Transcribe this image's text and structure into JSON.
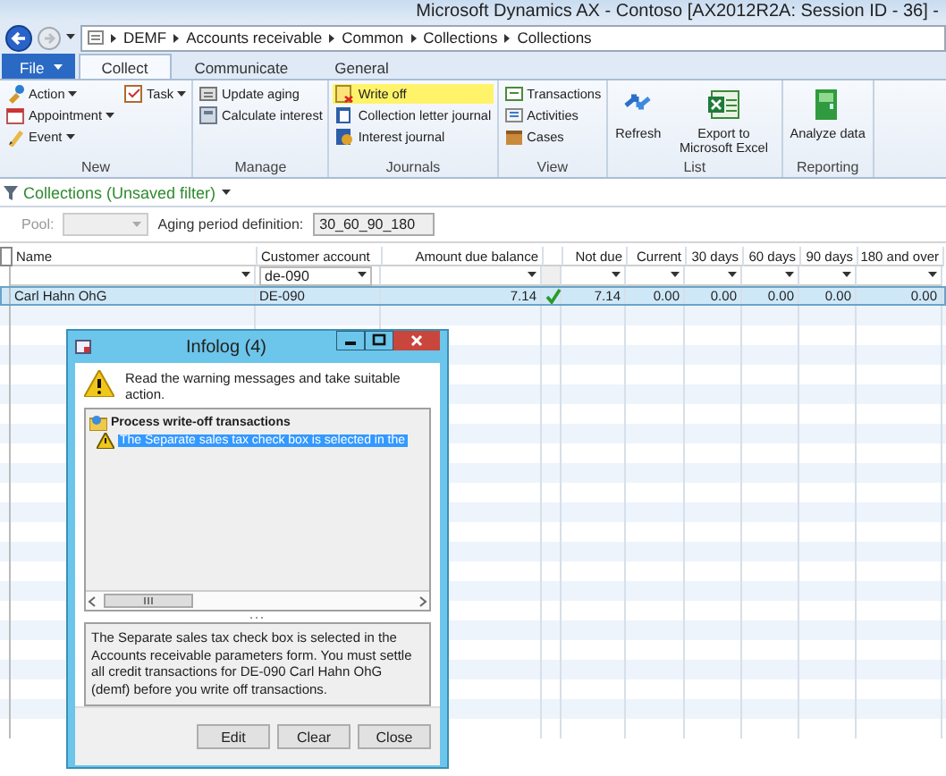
{
  "window": {
    "title": "Microsoft Dynamics AX - Contoso [AX2012R2A: Session ID - 36] -"
  },
  "breadcrumb": [
    "DEMF",
    "Accounts receivable",
    "Common",
    "Collections",
    "Collections"
  ],
  "ribbon_tabs": [
    {
      "label": "File",
      "kind": "file",
      "selected": false
    },
    {
      "label": "Collect",
      "kind": "tab",
      "selected": true
    },
    {
      "label": "Communicate",
      "kind": "tab",
      "selected": false
    },
    {
      "label": "General",
      "kind": "tab",
      "selected": false
    }
  ],
  "ribbon_groups": [
    {
      "label": "New",
      "columns": [
        [
          {
            "label": "Action",
            "kind": "small",
            "dropdown": true
          },
          {
            "label": "Appointment",
            "kind": "small",
            "dropdown": true
          },
          {
            "label": "Event",
            "kind": "small",
            "dropdown": true
          }
        ],
        [
          {
            "label": "Task",
            "kind": "small",
            "dropdown": true
          }
        ]
      ]
    },
    {
      "label": "Manage",
      "columns": [
        [
          {
            "label": "Update aging",
            "kind": "small",
            "dropdown": false
          },
          {
            "label": "Calculate interest",
            "kind": "small",
            "dropdown": false
          }
        ]
      ]
    },
    {
      "label": "Journals",
      "columns": [
        [
          {
            "label": "Write off",
            "kind": "small",
            "dropdown": false,
            "highlighted": true
          },
          {
            "label": "Collection letter journal",
            "kind": "small",
            "dropdown": false
          },
          {
            "label": "Interest journal",
            "kind": "small",
            "dropdown": false
          }
        ]
      ]
    },
    {
      "label": "View",
      "columns": [
        [
          {
            "label": "Transactions",
            "kind": "small",
            "dropdown": false
          },
          {
            "label": "Activities",
            "kind": "small",
            "dropdown": false
          },
          {
            "label": "Cases",
            "kind": "small",
            "dropdown": false
          }
        ]
      ]
    },
    {
      "label": "List",
      "columns": [
        [
          {
            "label": "Refresh",
            "kind": "large",
            "dropdown": false
          }
        ],
        [
          {
            "label": "Export to Microsoft Excel",
            "kind": "large",
            "dropdown": false
          }
        ]
      ]
    },
    {
      "label": "Reporting",
      "columns": [
        [
          {
            "label": "Analyze data",
            "kind": "large",
            "dropdown": false
          }
        ]
      ]
    }
  ],
  "filter_title": "Collections (Unsaved filter)",
  "fields": [
    {
      "label": "Pool:",
      "disabled": true
    },
    {
      "label": "Aging period definition:",
      "value": "30_60_90_180",
      "disabled": false
    }
  ],
  "grid": {
    "columns": [
      {
        "label": "Name",
        "kind": "text"
      },
      {
        "label": "Customer account",
        "kind": "text",
        "filter": "de-090"
      },
      {
        "label": "Amount due balance",
        "kind": "number"
      },
      {
        "kind": "mark"
      },
      {
        "label": "Not due",
        "kind": "number"
      },
      {
        "label": "Current",
        "kind": "number"
      },
      {
        "label": "30 days",
        "kind": "number"
      },
      {
        "label": "60 days",
        "kind": "number"
      },
      {
        "label": "90 days",
        "kind": "number"
      },
      {
        "label": "180 and over",
        "kind": "number"
      }
    ],
    "all_selected": false,
    "rows": [
      {
        "selected": true,
        "check": true,
        "cells": [
          "Carl Hahn OhG",
          "DE-090",
          "7.14",
          "",
          "7.14",
          "0.00",
          "0.00",
          "0.00",
          "0.00",
          "0.00"
        ]
      }
    ]
  },
  "infolog": {
    "title": "Infolog (4)",
    "message": "Read the warning messages and take suitable action.",
    "tree": [
      {
        "label": "Process write-off transactions",
        "selected": false,
        "children": [
          {
            "label": "The Separate sales tax check box is selected in the",
            "selected": true
          }
        ]
      }
    ],
    "detail": "The Separate sales tax check box is selected in the Accounts receivable parameters form. You must settle all credit transactions for DE-090 Carl Hahn OhG (demf) before you write off transactions.",
    "buttons": [
      "Edit",
      "Clear",
      "Close"
    ]
  }
}
